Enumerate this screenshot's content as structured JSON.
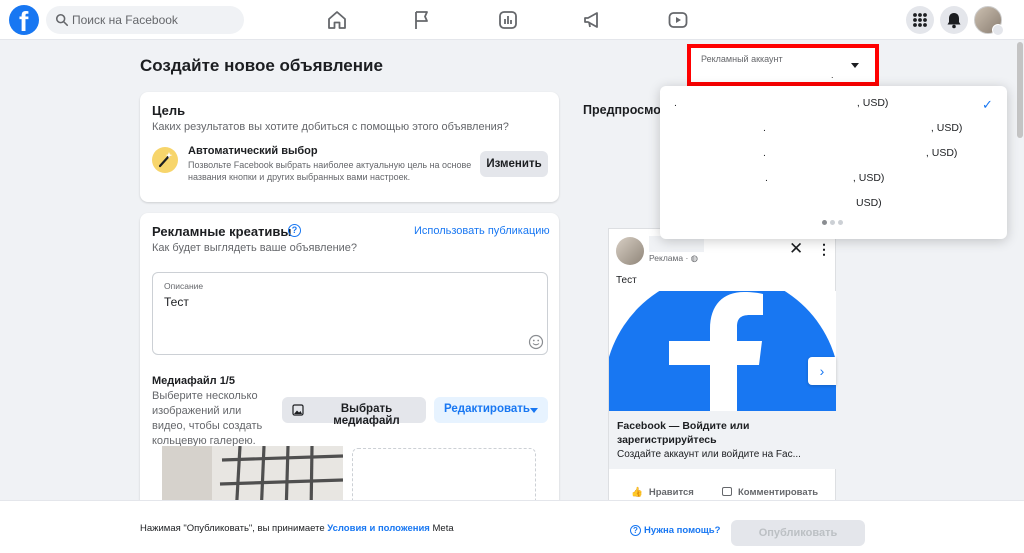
{
  "topbar": {
    "search_placeholder": "Поиск на Facebook",
    "nav_icons": [
      "home-icon",
      "flag-icon",
      "ads-chart-icon",
      "megaphone-icon",
      "video-icon"
    ],
    "right_icons": [
      "apps-grid-icon",
      "bell-icon"
    ]
  },
  "page": {
    "title": "Создайте новое объявление"
  },
  "goal": {
    "title": "Цель",
    "subtitle": "Каких результатов вы хотите добиться с помощью этого объявления?",
    "option_title": "Автоматический выбор",
    "option_desc": "Позвольте Facebook выбрать наиболее актуальную цель на основе названия кнопки и других выбранных вами настроек.",
    "change_button": "Изменить"
  },
  "creative": {
    "title": "Рекламные креативы",
    "subtitle": "Как будет выглядеть ваше объявление?",
    "use_post_link": "Использовать публикацию",
    "description_label": "Описание",
    "description_value": "Тест",
    "media_title": "Медиафайл 1/5",
    "media_hint": "Выберите несколько изображений или видео, чтобы создать кольцевую галерею.",
    "select_media_button": "Выбрать медиафайл",
    "edit_button": "Редактировать"
  },
  "ad_account": {
    "label": "Рекламный аккаунт",
    "selected_suffix": ".",
    "options": [
      {
        "prefix": ".",
        "suffix": ", USD)"
      },
      {
        "prefix": ".",
        "suffix": ", USD)"
      },
      {
        "prefix": ".",
        "suffix": ", USD)"
      },
      {
        "prefix": ".",
        "suffix": ", USD)"
      },
      {
        "prefix": "",
        "suffix": "USD)"
      }
    ]
  },
  "preview": {
    "title": "Предпросмотр",
    "sponsored": "Реклама · ",
    "post_text": "Тест",
    "link_title": "Facebook — Войдите или зарегистрируйтесь",
    "link_desc": "Создайте аккаунт или войдите на Fac...",
    "like_label": "Нравится",
    "comment_label": "Комментировать"
  },
  "footer": {
    "terms_prefix": "Нажимая \"Опубликовать\", вы принимаете ",
    "terms_link": "Условия и положения",
    "terms_suffix": " Meta",
    "help": "Нужна помощь?",
    "publish": "Опубликовать"
  },
  "colors": {
    "brand": "#1877f2",
    "highlight_border": "#ff0000",
    "background": "#f0f2f5"
  }
}
